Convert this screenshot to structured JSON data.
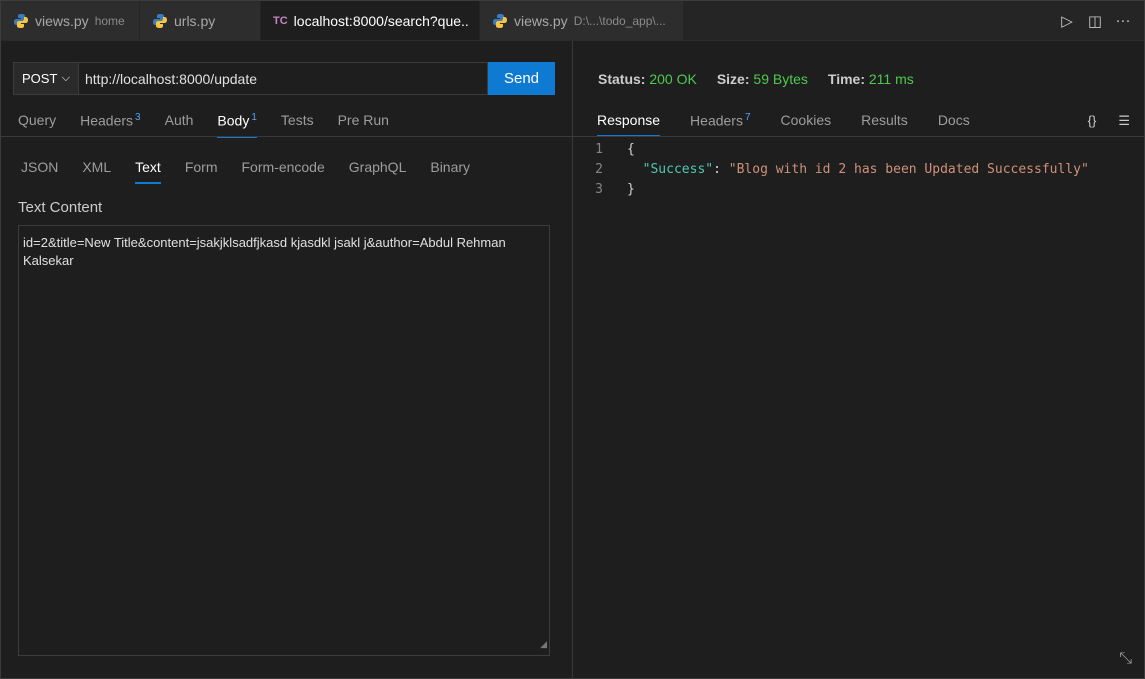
{
  "tabs": [
    {
      "icon": "python-icon",
      "label": "views.py",
      "desc": "home"
    },
    {
      "icon": "python-icon",
      "label": "urls.py",
      "desc": ""
    },
    {
      "icon": "thunder-client-icon",
      "icon_text": "TC",
      "label": "localhost:8000/search?que..",
      "desc": ""
    },
    {
      "icon": "python-icon",
      "label": "views.py",
      "desc": "D:\\...\\todo_app\\..."
    }
  ],
  "request": {
    "method": "POST",
    "url": "http://localhost:8000/update",
    "send_label": "Send",
    "tabs": [
      {
        "label": "Query",
        "badge": ""
      },
      {
        "label": "Headers",
        "badge": "3"
      },
      {
        "label": "Auth",
        "badge": ""
      },
      {
        "label": "Body",
        "badge": "1"
      },
      {
        "label": "Tests",
        "badge": ""
      },
      {
        "label": "Pre Run",
        "badge": ""
      }
    ],
    "body_tabs": [
      "JSON",
      "XML",
      "Text",
      "Form",
      "Form-encode",
      "GraphQL",
      "Binary"
    ],
    "text_label": "Text Content",
    "text_content": "id=2&title=New Title&content=jsakjklsadfjkasd kjasdkl jsakl j&author=Abdul Rehman Kalsekar"
  },
  "response": {
    "status_label": "Status:",
    "status_value": "200 OK",
    "size_label": "Size:",
    "size_value": "59 Bytes",
    "time_label": "Time:",
    "time_value": "211 ms",
    "tabs": [
      {
        "label": "Response",
        "badge": ""
      },
      {
        "label": "Headers",
        "badge": "7"
      },
      {
        "label": "Cookies",
        "badge": ""
      },
      {
        "label": "Results",
        "badge": ""
      },
      {
        "label": "Docs",
        "badge": ""
      }
    ],
    "format_icon_text": "{}",
    "lines": [
      {
        "num": "1",
        "text": "{"
      },
      {
        "num": "2",
        "key": "\"Success\"",
        "sep": ": ",
        "value": "\"Blog with id 2 has been Updated Successfully\""
      },
      {
        "num": "3",
        "text": "}"
      }
    ]
  },
  "colors": {
    "accent": "#0e7ad1",
    "status_ok": "#4ec94e",
    "json_key": "#4ec9b0",
    "json_string": "#ce9178"
  }
}
